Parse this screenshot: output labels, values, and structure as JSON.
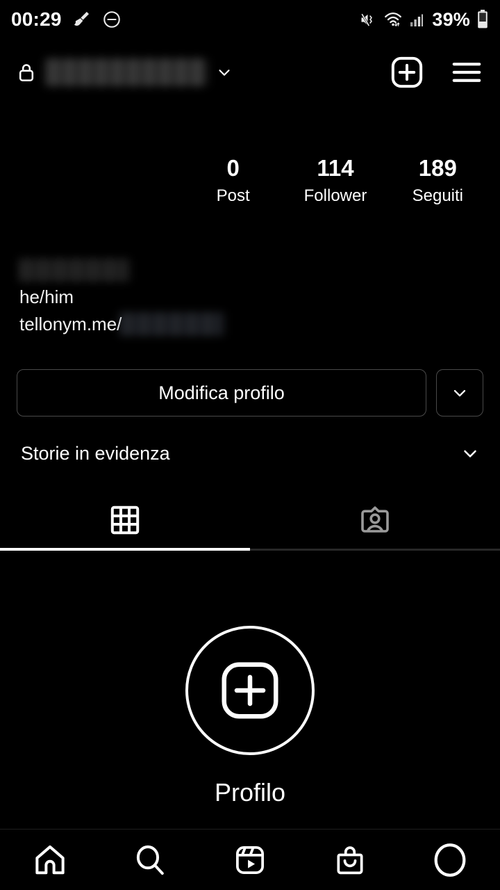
{
  "statusbar": {
    "clock": "00:29",
    "battery_percent": "39%",
    "icons": {
      "broom": "broom-icon",
      "dnd": "do-not-disturb-icon",
      "mute": "volume-mute-vibrate-icon",
      "wifi": "wifi-icon",
      "signal": "cellular-signal-icon",
      "battery": "battery-icon"
    }
  },
  "header": {
    "lock_icon": "lock-icon",
    "username_blurred": "",
    "chevron_icon": "chevron-down-icon",
    "add_icon": "add-post-icon",
    "menu_icon": "hamburger-menu-icon"
  },
  "stats": [
    {
      "value": "0",
      "label": "Post"
    },
    {
      "value": "114",
      "label": "Follower"
    },
    {
      "value": "189",
      "label": "Seguiti"
    }
  ],
  "bio": {
    "display_name_blurred": "",
    "pronouns": "he/him",
    "link_text": "tellonym.me/",
    "link_handle_blurred": ""
  },
  "actions": {
    "edit_profile_label": "Modifica profilo",
    "dropdown_icon": "chevron-down-icon"
  },
  "highlights": {
    "title": "Storie in evidenza",
    "caret_icon": "chevron-down-icon"
  },
  "tabs": [
    {
      "name": "grid",
      "icon": "grid-icon",
      "active": true
    },
    {
      "name": "tagged",
      "icon": "tagged-person-icon",
      "active": false
    }
  ],
  "empty_state": {
    "icon": "add-circle-icon",
    "label": "Profilo"
  },
  "bottom_nav": [
    {
      "name": "home",
      "icon": "home-icon"
    },
    {
      "name": "search",
      "icon": "search-icon"
    },
    {
      "name": "reels",
      "icon": "reels-icon"
    },
    {
      "name": "shop",
      "icon": "shopping-bag-icon"
    },
    {
      "name": "profile",
      "icon": "profile-avatar-icon"
    }
  ],
  "colors": {
    "background": "#000000",
    "text": "#ffffff",
    "border": "#4a4a4a",
    "inactive": "#8e8e8e"
  }
}
